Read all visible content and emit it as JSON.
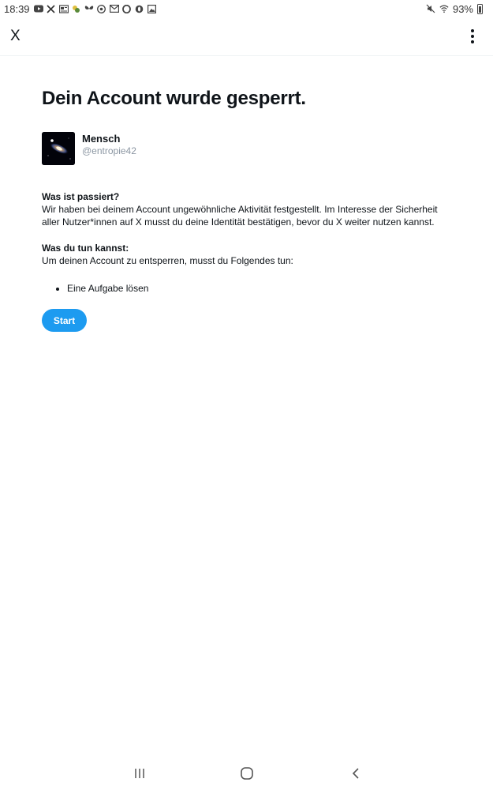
{
  "status_bar": {
    "time": "18:39",
    "battery": "93%",
    "left_icons": [
      "youtube-icon",
      "x-icon",
      "news-icon",
      "app-icon",
      "butterfly-icon",
      "chrome-icon",
      "mail-icon",
      "opera-icon",
      "opera-icon-2",
      "gallery-icon"
    ],
    "right_icons": [
      "mute-icon",
      "wifi-icon",
      "battery-icon"
    ]
  },
  "header": {
    "title": "X"
  },
  "main": {
    "title": "Dein Account wurde gesperrt.",
    "profile": {
      "name": "Mensch",
      "handle": "@entropie42"
    },
    "what_happened": {
      "heading": "Was ist passiert?",
      "text": "Wir haben bei deinem Account ungewöhnliche Aktivität festgestellt. Im Interesse der Sicherheit aller Nutzer*innen auf X musst du deine Identität bestätigen, bevor du X weiter nutzen kannst."
    },
    "what_you_can_do": {
      "heading": "Was du tun kannst:",
      "text": "Um deinen Account zu entsperren, musst du Folgendes tun:",
      "tasks": [
        "Eine Aufgabe lösen"
      ]
    },
    "start_label": "Start"
  },
  "colors": {
    "accent": "#1d9bf0",
    "text": "#0f1419",
    "handle": "#8c97a3"
  }
}
